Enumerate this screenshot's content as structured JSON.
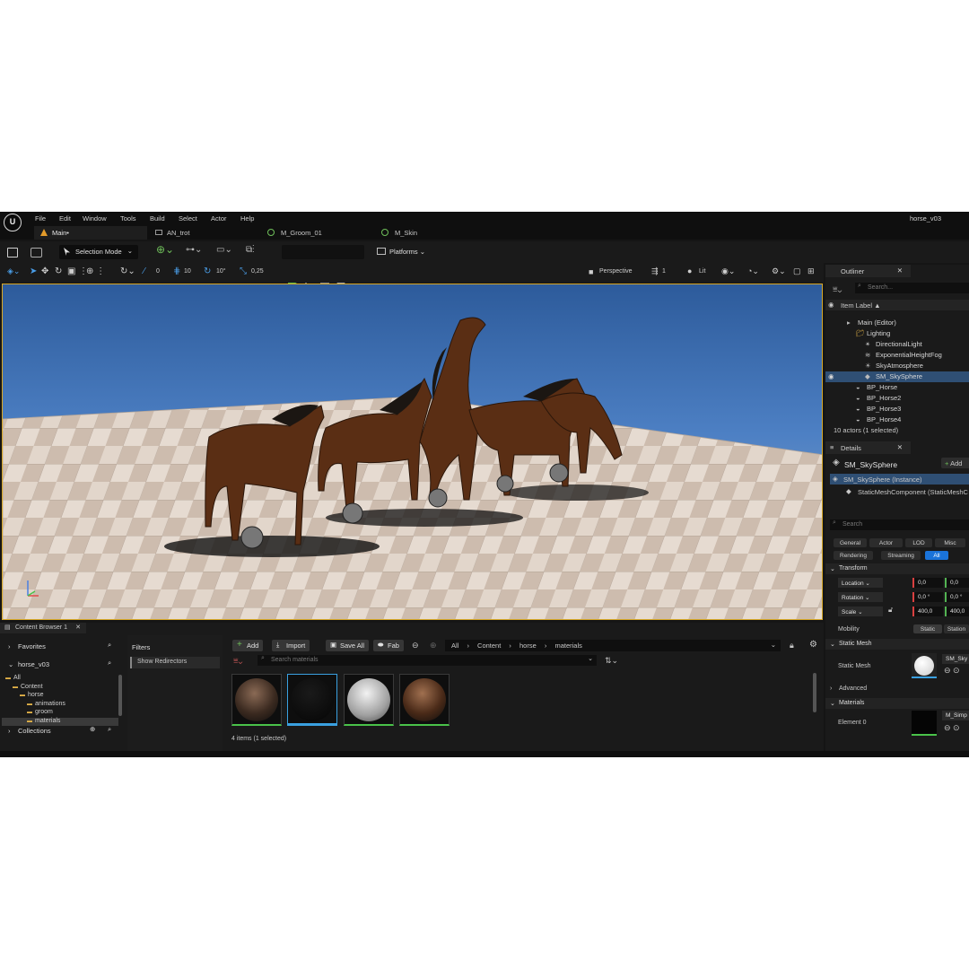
{
  "menu": {
    "items": [
      "File",
      "Edit",
      "Window",
      "Tools",
      "Build",
      "Select",
      "Actor",
      "Help"
    ],
    "project_name": "horse_v03"
  },
  "tabs": [
    {
      "label": "Main•",
      "active": true
    },
    {
      "label": "AN_trot"
    },
    {
      "label": "M_Groom_01"
    },
    {
      "label": "M_Skin"
    }
  ],
  "toolbar": {
    "selection_mode": "Selection Mode",
    "platforms": "Platforms"
  },
  "viewport_toolbar": {
    "angle_snap": "0",
    "grid_snap": "10",
    "rot_snap": "10°",
    "scale_snap": "0,25",
    "view_mode": "Perspective",
    "speed": "1",
    "lit": "Lit"
  },
  "outliner": {
    "title": "Outliner",
    "search_placeholder": "Search...",
    "column": "Item Label ▲",
    "rows": [
      {
        "label": "Main (Editor)",
        "indent": 1
      },
      {
        "label": "Lighting",
        "indent": 2
      },
      {
        "label": "DirectionalLight",
        "indent": 3
      },
      {
        "label": "ExponentialHeightFog",
        "indent": 3
      },
      {
        "label": "SkyAtmosphere",
        "indent": 3
      },
      {
        "label": "SM_SkySphere",
        "indent": 3,
        "selected": true
      },
      {
        "label": "BP_Horse",
        "indent": 2
      },
      {
        "label": "BP_Horse2",
        "indent": 2
      },
      {
        "label": "BP_Horse3",
        "indent": 2
      },
      {
        "label": "BP_Horse4",
        "indent": 2
      }
    ],
    "footer": "10 actors (1 selected)"
  },
  "details": {
    "title": "Details",
    "object_name": "SM_SkySphere",
    "add_label": "Add",
    "instance_row": "SM_SkySphere (Instance)",
    "component_row": "StaticMeshComponent (StaticMeshC",
    "search_placeholder": "Search",
    "filter_chips": [
      "General",
      "Actor",
      "LOD",
      "Misc",
      "Rendering",
      "Streaming",
      "All"
    ],
    "transform_header": "Transform",
    "location_label": "Location",
    "rotation_label": "Rotation",
    "scale_label": "Scale",
    "location_values": [
      "0,0",
      "0,0"
    ],
    "rotation_values": [
      "0,0 °",
      "0,0 °"
    ],
    "scale_values": [
      "400,0",
      "400,0"
    ],
    "mobility_label": "Mobility",
    "mobility_options": [
      "Static",
      "Station"
    ],
    "static_mesh_header": "Static Mesh",
    "static_mesh_label": "Static Mesh",
    "static_mesh_value": "SM_Sky",
    "advanced_label": "Advanced",
    "materials_header": "Materials",
    "element0_label": "Element 0",
    "element0_value": "M_Simp"
  },
  "content_browser": {
    "tab_label": "Content Browser 1",
    "favorites": "Favorites",
    "project": "horse_v03",
    "tree": [
      {
        "label": "All",
        "depth": 0
      },
      {
        "label": "Content",
        "depth": 1
      },
      {
        "label": "horse",
        "depth": 2
      },
      {
        "label": "animations",
        "depth": 3
      },
      {
        "label": "groom",
        "depth": 3
      },
      {
        "label": "materials",
        "depth": 3,
        "selected": true
      }
    ],
    "collections": "Collections",
    "filters_header": "Filters",
    "show_redirectors": "Show Redirectors",
    "buttons": {
      "add": "Add",
      "import": "Import",
      "save_all": "Save All",
      "fab": "Fab"
    },
    "breadcrumb": [
      "All",
      "Content",
      "horse",
      "materials"
    ],
    "search_placeholder": "Search materials",
    "status": "4 items (1 selected)"
  }
}
